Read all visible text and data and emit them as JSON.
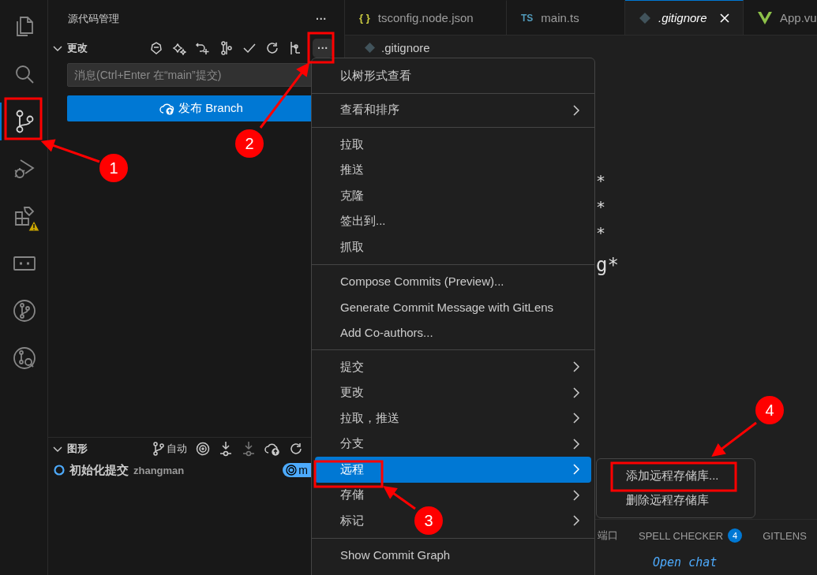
{
  "activity_bar": {
    "items": [
      {
        "kind": "files",
        "selected": false,
        "warning": false
      },
      {
        "kind": "search",
        "selected": false,
        "warning": false
      },
      {
        "kind": "source_control",
        "selected": true,
        "warning": false
      },
      {
        "kind": "run_debug",
        "selected": false,
        "warning": false
      },
      {
        "kind": "extensions",
        "selected": false,
        "warning": true
      },
      {
        "kind": "remote",
        "selected": false,
        "warning": false
      },
      {
        "kind": "git_branch",
        "selected": false,
        "warning": false
      },
      {
        "kind": "git_inspect",
        "selected": false,
        "warning": false
      }
    ]
  },
  "sidebar": {
    "title": "源代码管理",
    "more": "···",
    "changes": {
      "label": "更改",
      "expanded": true,
      "more": "···",
      "message_placeholder": "消息(Ctrl+Enter 在“main”提交)",
      "publish_button": "发布 Branch"
    },
    "graph": {
      "label": "图形",
      "expanded": true,
      "auto": "自动",
      "commits": [
        {
          "message": "初始化提交",
          "author": "zhangman",
          "ref": "m"
        }
      ]
    }
  },
  "editor": {
    "tabs": [
      {
        "kind": "json",
        "icon_text": "{ }",
        "label": "tsconfig.node.json",
        "selected": false
      },
      {
        "kind": "ts",
        "icon_text": "TS",
        "label": "main.ts",
        "selected": false
      },
      {
        "kind": "git",
        "label": ".gitignore",
        "selected": true
      },
      {
        "kind": "vue",
        "label": "App.vu",
        "selected": false
      }
    ],
    "breadcrumb": ".gitignore",
    "code_lines": [
      "*",
      "*",
      "*",
      "g*"
    ],
    "panel_tabs": [
      {
        "label": "端口"
      },
      {
        "label": "SPELL CHECKER",
        "badge": "4"
      },
      {
        "label": "GITLENS"
      }
    ],
    "panel_line": "Open chat"
  },
  "context_menu": {
    "groups": [
      [
        {
          "label": "以树形式查看",
          "submenu": false,
          "selected": false
        }
      ],
      [
        {
          "label": "查看和排序",
          "submenu": true,
          "selected": false
        }
      ],
      [
        {
          "label": "拉取",
          "submenu": false,
          "selected": false
        },
        {
          "label": "推送",
          "submenu": false,
          "selected": false
        },
        {
          "label": "克隆",
          "submenu": false,
          "selected": false
        },
        {
          "label": "签出到...",
          "submenu": false,
          "selected": false
        },
        {
          "label": "抓取",
          "submenu": false,
          "selected": false
        }
      ],
      [
        {
          "label": "Compose Commits (Preview)...",
          "submenu": false,
          "selected": false
        },
        {
          "label": "Generate Commit Message with GitLens",
          "submenu": false,
          "selected": false
        },
        {
          "label": "Add Co-authors...",
          "submenu": false,
          "selected": false
        }
      ],
      [
        {
          "label": "提交",
          "submenu": true,
          "selected": false
        },
        {
          "label": "更改",
          "submenu": true,
          "selected": false
        },
        {
          "label": "拉取，推送",
          "submenu": true,
          "selected": false
        },
        {
          "label": "分支",
          "submenu": true,
          "selected": false
        },
        {
          "label": "远程",
          "submenu": true,
          "selected": true
        },
        {
          "label": "存储",
          "submenu": true,
          "selected": false
        },
        {
          "label": "标记",
          "submenu": true,
          "selected": false
        }
      ],
      [
        {
          "label": "Show Commit Graph",
          "submenu": false,
          "selected": false
        }
      ]
    ],
    "submenu": [
      {
        "label": "添加远程存储库...",
        "selected": false
      },
      {
        "label": "删除远程存储库",
        "selected": false
      }
    ]
  },
  "annotations": [
    {
      "number": "1"
    },
    {
      "number": "2"
    },
    {
      "number": "3"
    },
    {
      "number": "4"
    }
  ]
}
